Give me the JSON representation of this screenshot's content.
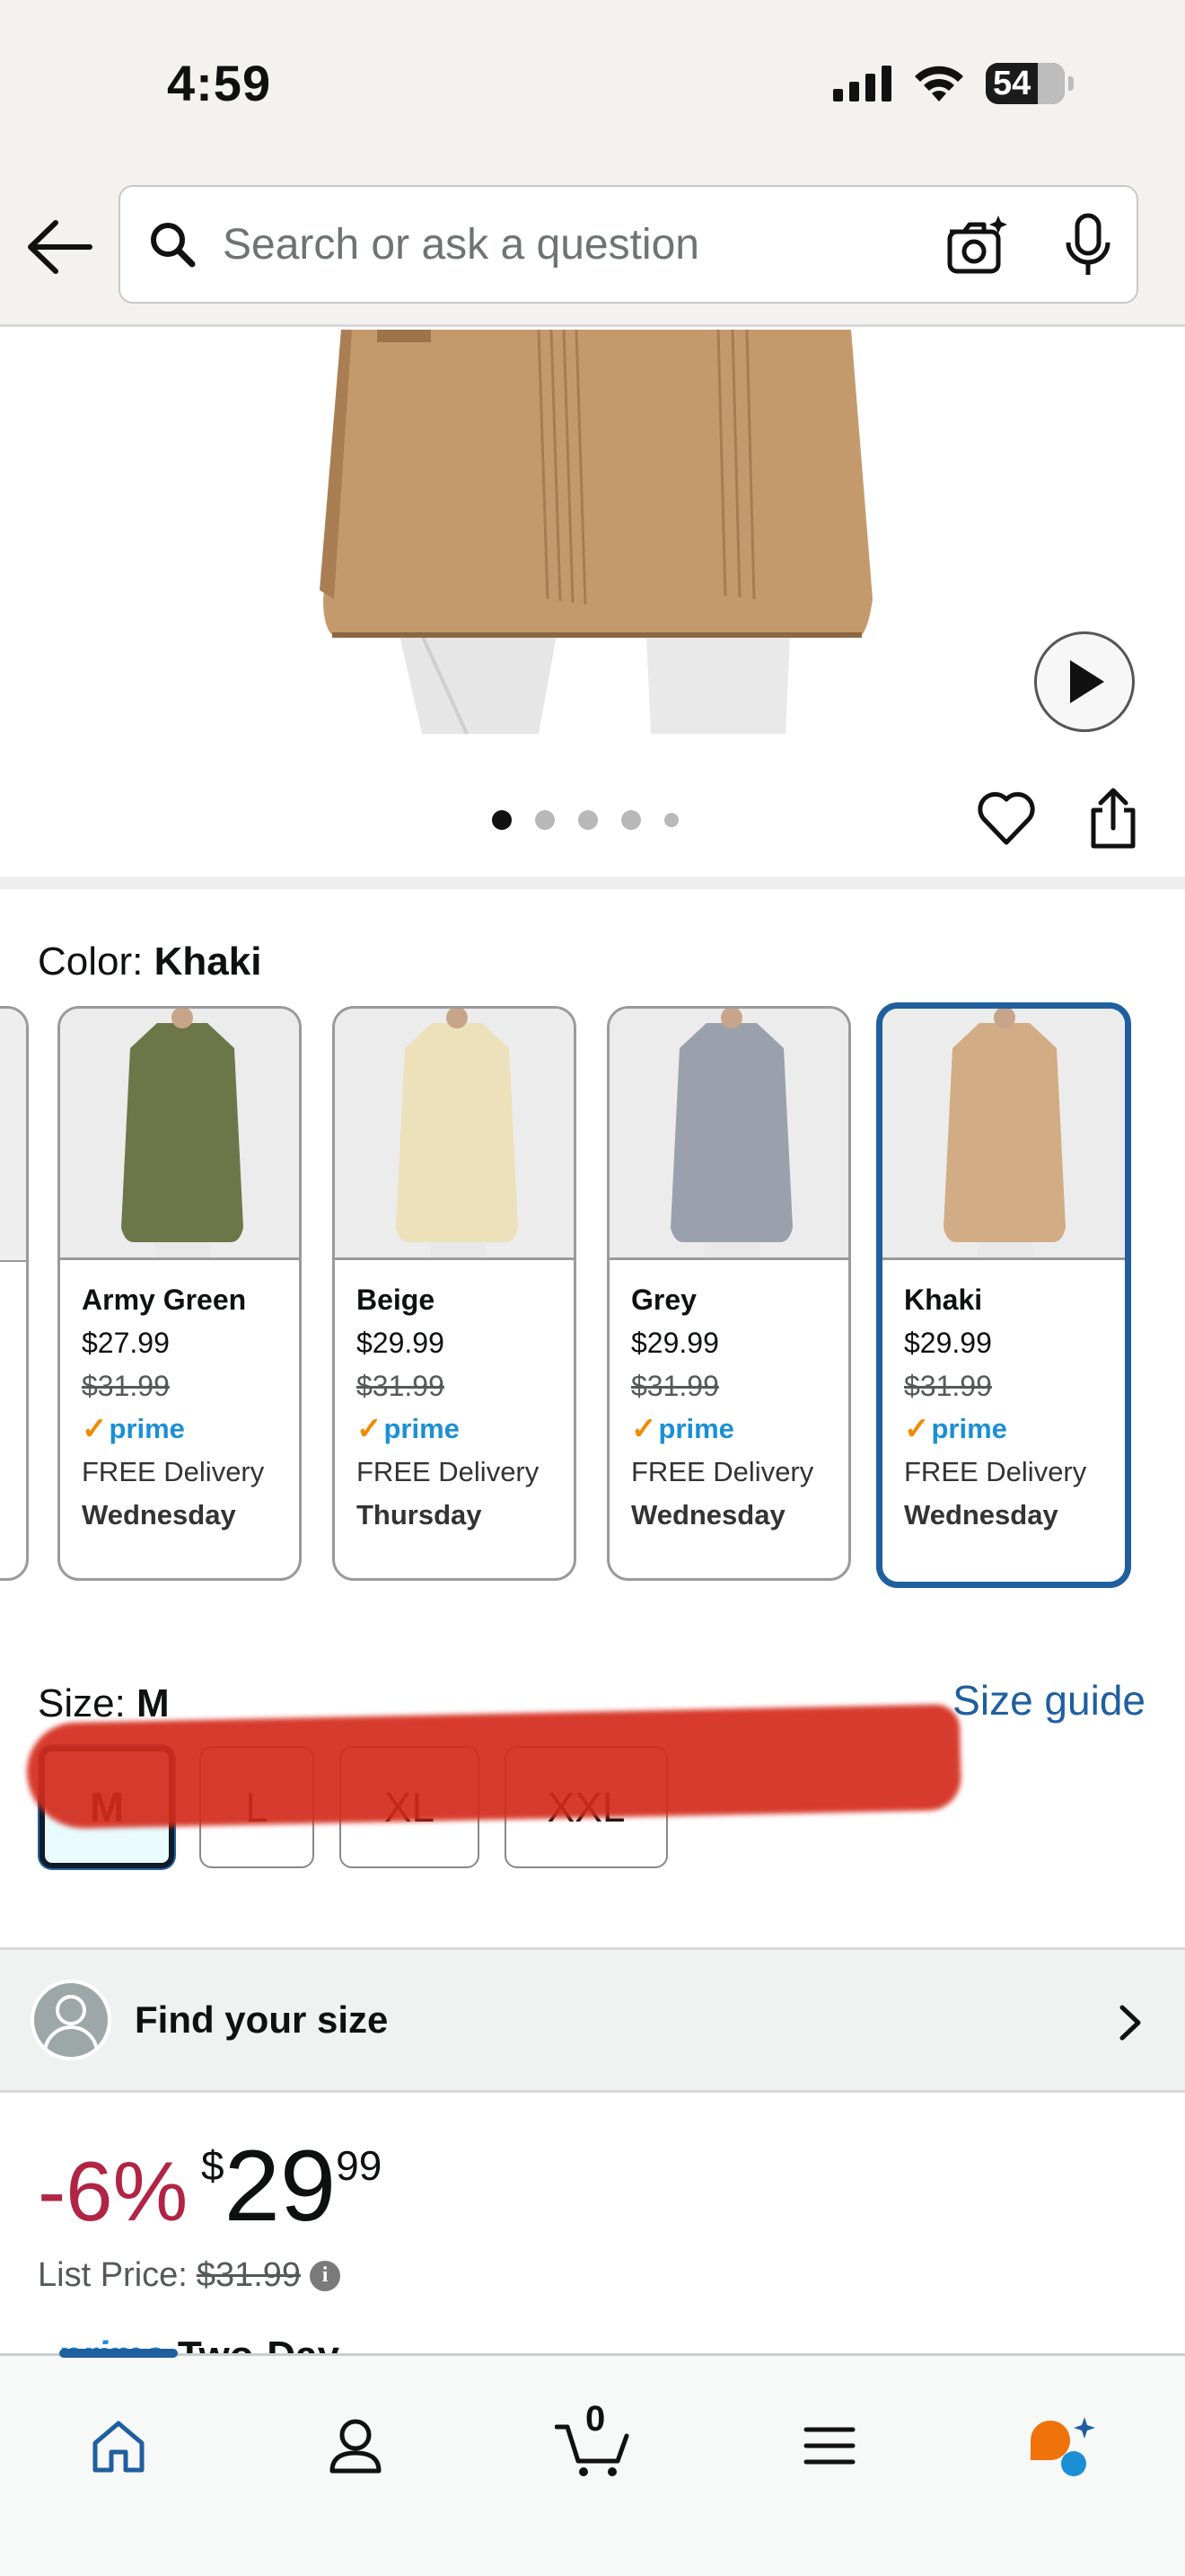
{
  "status_bar": {
    "time": "4:59",
    "battery": "54"
  },
  "search": {
    "placeholder": "Search or ask a question"
  },
  "color": {
    "label": "Color: ",
    "selected": "Khaki",
    "options": [
      {
        "name": "Army Green",
        "price": "$27.99",
        "list_price": "$31.99",
        "badge": "prime",
        "delivery": "FREE Delivery",
        "day": "Wednesday",
        "color": "#6d7649"
      },
      {
        "name": "Beige",
        "price": "$29.99",
        "list_price": "$31.99",
        "badge": "prime",
        "delivery": "FREE Delivery",
        "day": "Thursday",
        "color": "#ece1ba"
      },
      {
        "name": "Grey",
        "price": "$29.99",
        "list_price": "$31.99",
        "badge": "prime",
        "delivery": "FREE Delivery",
        "day": "Wednesday",
        "color": "#9aa1ad"
      },
      {
        "name": "Khaki",
        "price": "$29.99",
        "list_price": "$31.99",
        "badge": "prime",
        "delivery": "FREE Delivery",
        "day": "Wednesday",
        "color": "#d1ac84"
      }
    ]
  },
  "size": {
    "label": "Size: ",
    "selected": "M",
    "guide": "Size guide",
    "options": [
      "M",
      "L",
      "XL",
      "XXL"
    ]
  },
  "find_size": {
    "label": "Find your size"
  },
  "price": {
    "discount": "-6%",
    "currency": "$",
    "whole": "29",
    "fraction": "99",
    "list_label": "List Price:",
    "list_value": "$31.99"
  },
  "prime_peek": {
    "badge": "prime",
    "text": "Two-Day"
  },
  "cart": {
    "count": "0"
  },
  "colors": {
    "accent_blue": "#1f5f9f",
    "discount_red": "#b12444",
    "prime_blue": "#1a8fd6"
  }
}
